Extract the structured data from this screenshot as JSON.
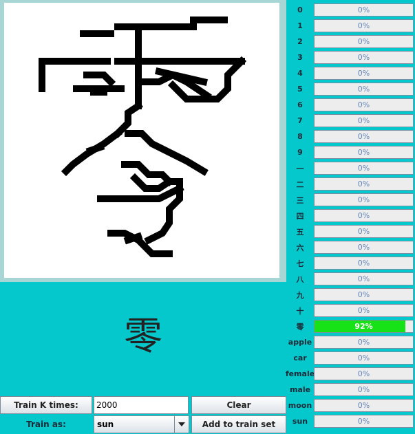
{
  "result_character": "零",
  "controls": {
    "train_k_label": "Train K times:",
    "train_k_value": "2000",
    "clear_label": "Clear",
    "train_as_label": "Train as:",
    "train_as_value": "sun",
    "add_label": "Add to train set"
  },
  "colors": {
    "fill": "#17e217",
    "bar_bg": "#ededed",
    "background": "#05c8cc"
  },
  "classes": [
    {
      "label": "0",
      "value": 0,
      "text": "0%"
    },
    {
      "label": "1",
      "value": 0,
      "text": "0%"
    },
    {
      "label": "2",
      "value": 0,
      "text": "0%"
    },
    {
      "label": "3",
      "value": 0,
      "text": "0%"
    },
    {
      "label": "4",
      "value": 0,
      "text": "0%"
    },
    {
      "label": "5",
      "value": 0,
      "text": "0%"
    },
    {
      "label": "6",
      "value": 0,
      "text": "0%"
    },
    {
      "label": "7",
      "value": 0,
      "text": "0%"
    },
    {
      "label": "8",
      "value": 0,
      "text": "0%"
    },
    {
      "label": "9",
      "value": 0,
      "text": "0%"
    },
    {
      "label": "一",
      "value": 0,
      "text": "0%"
    },
    {
      "label": "二",
      "value": 0,
      "text": "0%"
    },
    {
      "label": "三",
      "value": 0,
      "text": "0%"
    },
    {
      "label": "四",
      "value": 0,
      "text": "0%"
    },
    {
      "label": "五",
      "value": 0,
      "text": "0%"
    },
    {
      "label": "六",
      "value": 0,
      "text": "0%"
    },
    {
      "label": "七",
      "value": 0,
      "text": "0%"
    },
    {
      "label": "八",
      "value": 0,
      "text": "0%"
    },
    {
      "label": "九",
      "value": 0,
      "text": "0%"
    },
    {
      "label": "十",
      "value": 0,
      "text": "0%"
    },
    {
      "label": "零",
      "value": 0.92,
      "text": "92%"
    },
    {
      "label": "apple",
      "value": 0,
      "text": "0%"
    },
    {
      "label": "car",
      "value": 0,
      "text": "0%"
    },
    {
      "label": "female",
      "value": 0,
      "text": "0%"
    },
    {
      "label": "male",
      "value": 0,
      "text": "0%"
    },
    {
      "label": "moon",
      "value": 0,
      "text": "0%"
    },
    {
      "label": "sun",
      "value": 0,
      "text": "0%"
    }
  ]
}
